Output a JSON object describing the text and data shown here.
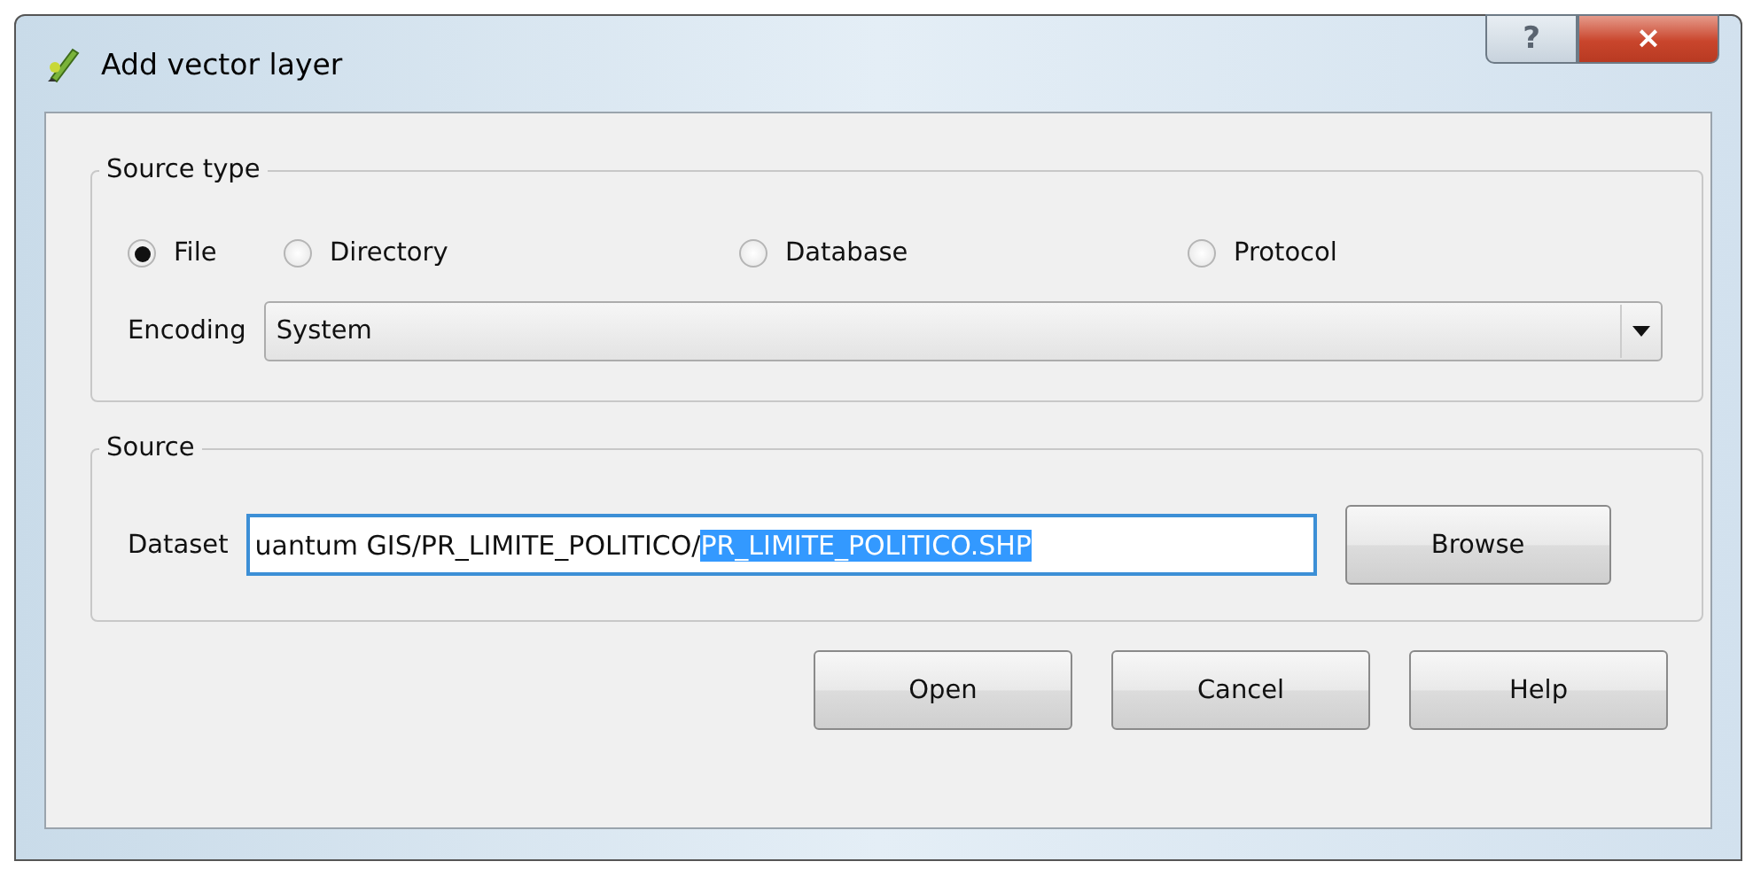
{
  "window": {
    "title": "Add vector layer",
    "help_button": "?",
    "close_button": "×"
  },
  "source_type": {
    "title": "Source type",
    "options": [
      {
        "label": "File",
        "selected": true
      },
      {
        "label": "Directory",
        "selected": false
      },
      {
        "label": "Database",
        "selected": false
      },
      {
        "label": "Protocol",
        "selected": false
      }
    ],
    "encoding": {
      "label": "Encoding",
      "value": "System"
    }
  },
  "source": {
    "title": "Source",
    "dataset": {
      "label": "Dataset",
      "value": "uantum GIS/PR_LIMITE_POLITICO/",
      "selection": "PR_LIMITE_POLITICO.SHP"
    },
    "browse_button": "Browse"
  },
  "buttons": [
    "Open",
    "Cancel",
    "Help"
  ]
}
